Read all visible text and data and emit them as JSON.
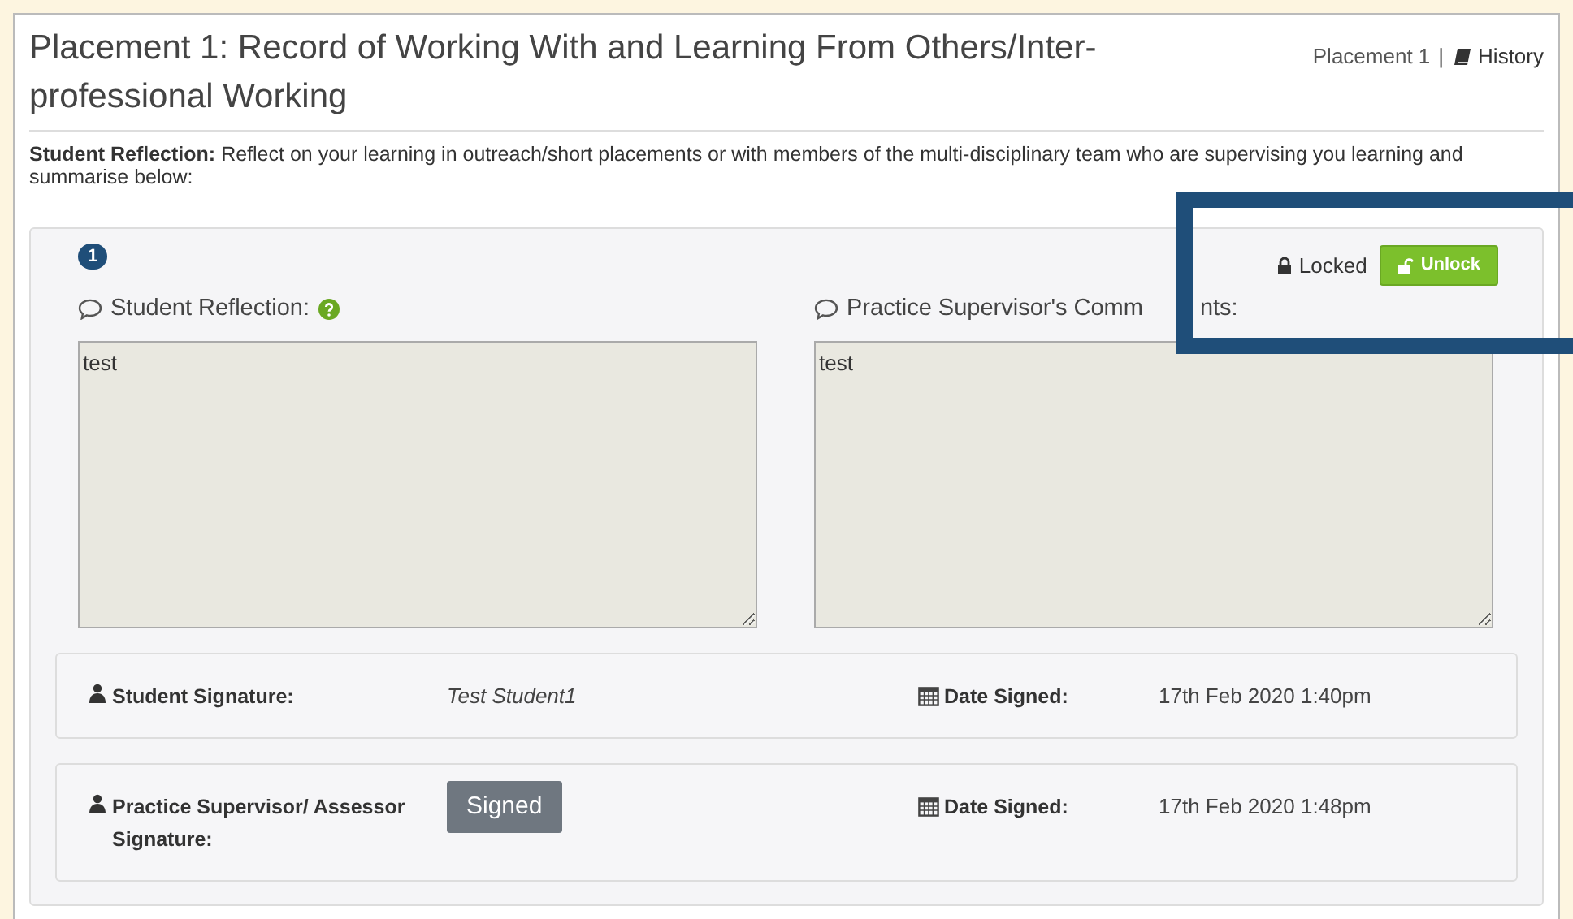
{
  "header": {
    "title": "Placement 1: Record of Working With and Learning From Others/Inter-professional Working",
    "breadcrumb": "Placement 1",
    "separator": "|",
    "history_link": "History"
  },
  "intro": "**Student Reflection:** Reflect on your learning in outreach/short placements or with members of the multi-disciplinary team who are supervising you learning and summarise below:",
  "entry": {
    "number": "1",
    "lock_status": "Locked",
    "unlock_button": "Unlock",
    "fields": [
      {
        "label": "Student Reflection:",
        "help": true,
        "value": "test"
      },
      {
        "label": "Practice Supervisor's Comm",
        "label_after_frame": "nts:",
        "help": false,
        "value": "test"
      }
    ],
    "signatures": [
      {
        "label": "Student Signature:",
        "kind": "text",
        "value": "Test Student1",
        "date_label": "Date Signed:",
        "date": "17th Feb 2020 1:40pm"
      },
      {
        "label": "Practice Supervisor/ Assessor Signature:",
        "kind": "badge",
        "value": "Signed",
        "date_label": "Date Signed:",
        "date": "17th Feb 2020 1:48pm"
      }
    ]
  }
}
